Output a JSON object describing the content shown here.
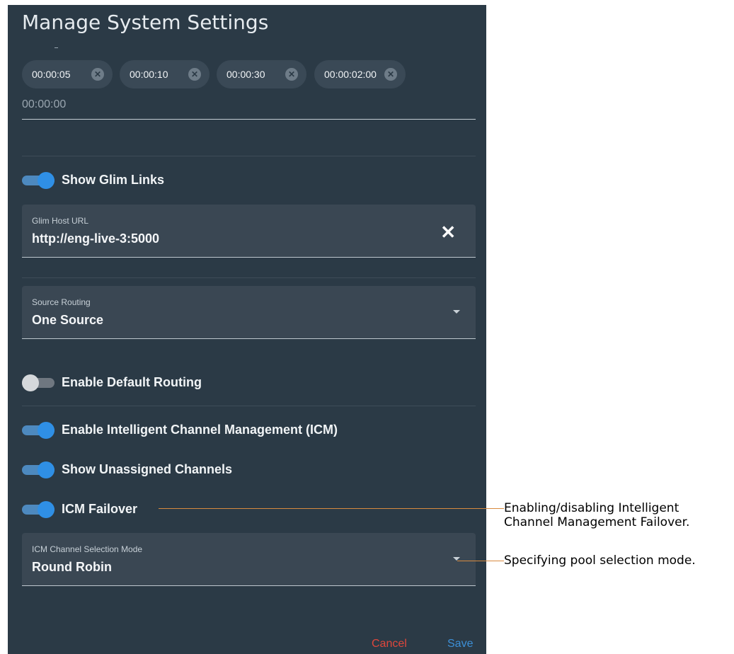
{
  "dialog": {
    "title": "Manage System Settings",
    "chips": [
      "00:00:05",
      "00:00:10",
      "00:00:30",
      "00:00:02:00"
    ],
    "time_input_value": "00:00:00",
    "show_glim_links": {
      "label": "Show Glim Links",
      "on": true
    },
    "glim_host": {
      "label": "Glim Host URL",
      "value": "http://eng-live-3:5000",
      "clear_icon": "close-icon"
    },
    "source_routing": {
      "label": "Source Routing",
      "value": "One Source"
    },
    "enable_default_routing": {
      "label": "Enable Default Routing",
      "on": false
    },
    "enable_icm": {
      "label": "Enable Intelligent Channel Management (ICM)",
      "on": true
    },
    "show_unassigned": {
      "label": "Show Unassigned Channels",
      "on": true
    },
    "icm_failover": {
      "label": "ICM Failover",
      "on": true
    },
    "icm_selection_mode": {
      "label": "ICM Channel Selection Mode",
      "value": "Round Robin"
    },
    "cancel_label": "Cancel",
    "save_label": "Save"
  },
  "callouts": {
    "failover_line1": "Enabling/disabling Intelligent",
    "failover_line2": "Channel Management Failover.",
    "selection_mode": "Specifying pool selection mode."
  },
  "colors": {
    "panel_bg": "#2b3a46",
    "toggle_on": "#2f8fe5",
    "cancel": "#e0473c",
    "save": "#3d8fd6",
    "callout_line": "#d88a3f"
  }
}
